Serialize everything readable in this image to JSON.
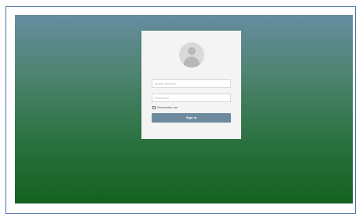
{
  "login": {
    "mobile_placeholder": "Mobile Number",
    "password_placeholder": "Password",
    "remember_label": "Remember me",
    "signin_label": "Sign in"
  },
  "icons": {
    "avatar": "user-avatar-icon"
  }
}
